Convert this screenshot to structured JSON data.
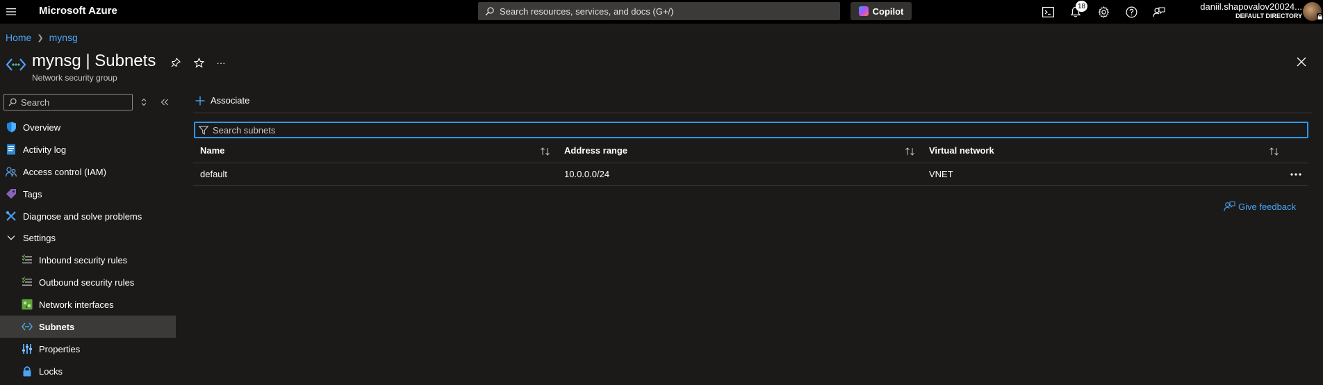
{
  "topbar": {
    "brand": "Microsoft Azure",
    "search_placeholder": "Search resources, services, and docs (G+/)",
    "copilot_label": "Copilot",
    "notification_count": "18",
    "user_name": "daniil.shapovalov20024...",
    "directory": "DEFAULT DIRECTORY"
  },
  "breadcrumb": {
    "home": "Home",
    "resource": "mynsg"
  },
  "header": {
    "title": "mynsg | Subnets",
    "subtitle": "Network security group",
    "more_label": "···"
  },
  "sidebar": {
    "search_placeholder": "Search",
    "items": [
      {
        "label": "Overview",
        "icon": "shield-icon"
      },
      {
        "label": "Activity log",
        "icon": "activity-log-icon"
      },
      {
        "label": "Access control (IAM)",
        "icon": "people-icon"
      },
      {
        "label": "Tags",
        "icon": "tag-icon"
      },
      {
        "label": "Diagnose and solve problems",
        "icon": "wrench-icon"
      },
      {
        "label": "Settings",
        "icon": "chevron-down-icon"
      },
      {
        "label": "Inbound security rules",
        "icon": "inbound-rules-icon"
      },
      {
        "label": "Outbound security rules",
        "icon": "outbound-rules-icon"
      },
      {
        "label": "Network interfaces",
        "icon": "network-interface-icon"
      },
      {
        "label": "Subnets",
        "icon": "subnet-icon"
      },
      {
        "label": "Properties",
        "icon": "properties-icon"
      },
      {
        "label": "Locks",
        "icon": "lock-icon"
      }
    ],
    "active_item": "Subnets"
  },
  "toolbar": {
    "associate_label": "Associate"
  },
  "filter": {
    "placeholder": "Search subnets"
  },
  "table": {
    "columns": [
      "Name",
      "Address range",
      "Virtual network"
    ],
    "rows": [
      {
        "name": "default",
        "address_range": "10.0.0.0/24",
        "virtual_network": "VNET"
      }
    ]
  },
  "feedback_label": "Give feedback",
  "colors": {
    "accent": "#4ba3f5",
    "focus_border": "#2899f5",
    "background": "#1b1a19",
    "topbar": "#000000",
    "active_item": "#3b3a39"
  }
}
